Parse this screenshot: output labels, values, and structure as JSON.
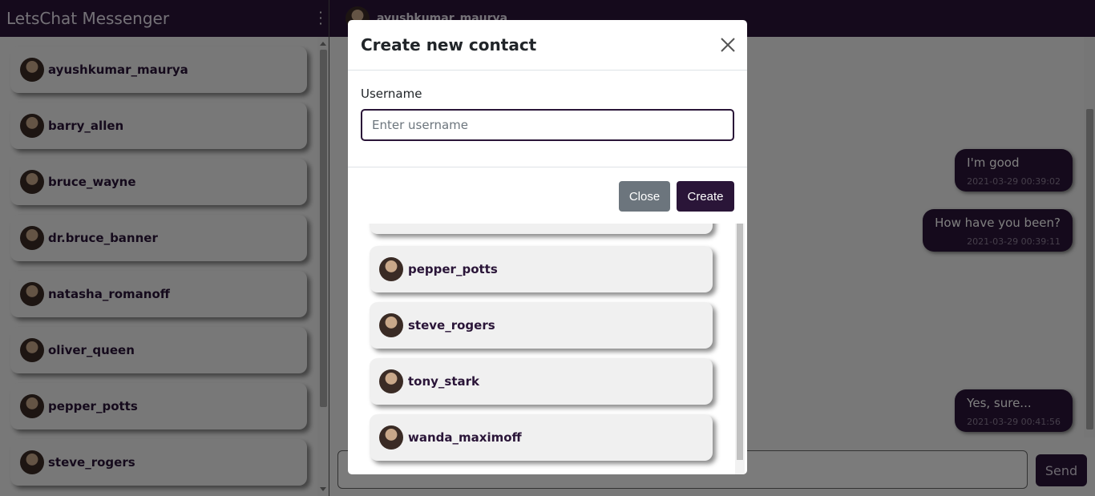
{
  "app": {
    "title": "LetsChat Messenger"
  },
  "sidebar": {
    "contacts": [
      {
        "name": "ayushkumar_maurya"
      },
      {
        "name": "barry_allen"
      },
      {
        "name": "bruce_wayne"
      },
      {
        "name": "dr.bruce_banner"
      },
      {
        "name": "natasha_romanoff"
      },
      {
        "name": "oliver_queen"
      },
      {
        "name": "pepper_potts"
      },
      {
        "name": "steve_rogers"
      }
    ]
  },
  "chat": {
    "header_user": "ayushkumar_maurya",
    "messages": [
      {
        "text": "I'm good",
        "time": "2021-03-29 00:39:02"
      },
      {
        "text": "How have you been?",
        "time": "2021-03-29 00:39:11"
      },
      {
        "text": "Yes, sure...",
        "time": "2021-03-29 00:41:56"
      }
    ],
    "send_label": "Send"
  },
  "contact_picker": {
    "items": [
      {
        "name": "pepper_potts"
      },
      {
        "name": "steve_rogers"
      },
      {
        "name": "tony_stark"
      },
      {
        "name": "wanda_maximoff"
      }
    ]
  },
  "dialog": {
    "title": "Create new contact",
    "username_label": "Username",
    "username_placeholder": "Enter username",
    "username_value": "",
    "close_label": "Close",
    "create_label": "Create"
  },
  "colors": {
    "brand": "#2a1538",
    "secondary": "#6c757d"
  }
}
